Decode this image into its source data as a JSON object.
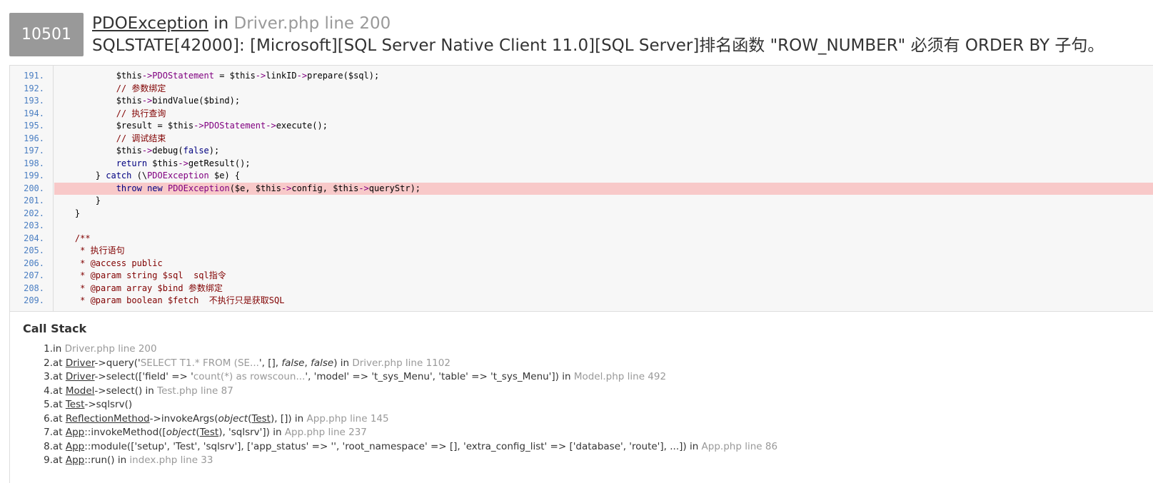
{
  "header": {
    "code": "10501",
    "exception_class": "PDOException",
    "in_word": "in",
    "location": "Driver.php line 200",
    "message": "SQLSTATE[42000]: [Microsoft][SQL Server Native Client 11.0][SQL Server]排名函数 \"ROW_NUMBER\" 必须有 ORDER BY 子句。"
  },
  "source": {
    "highlight_line": "200.",
    "lines": [
      {
        "no": "191.",
        "code": "            $this->PDOStatement = $this->linkID->prepare($sql);"
      },
      {
        "no": "192.",
        "code": "            // 参数绑定"
      },
      {
        "no": "193.",
        "code": "            $this->bindValue($bind);"
      },
      {
        "no": "194.",
        "code": "            // 执行查询"
      },
      {
        "no": "195.",
        "code": "            $result = $this->PDOStatement->execute();"
      },
      {
        "no": "196.",
        "code": "            // 调试结束"
      },
      {
        "no": "197.",
        "code": "            $this->debug(false);"
      },
      {
        "no": "198.",
        "code": "            return $this->getResult();"
      },
      {
        "no": "199.",
        "code": "        } catch (\\PDOException $e) {"
      },
      {
        "no": "200.",
        "code": "            throw new PDOException($e, $this->config, $this->queryStr);"
      },
      {
        "no": "201.",
        "code": "        }"
      },
      {
        "no": "202.",
        "code": "    }"
      },
      {
        "no": "203.",
        "code": ""
      },
      {
        "no": "204.",
        "code": "    /**"
      },
      {
        "no": "205.",
        "code": "     * 执行语句"
      },
      {
        "no": "206.",
        "code": "     * @access public"
      },
      {
        "no": "207.",
        "code": "     * @param string $sql  sql指令"
      },
      {
        "no": "208.",
        "code": "     * @param array $bind 参数绑定"
      },
      {
        "no": "209.",
        "code": "     * @param boolean $fetch  不执行只是获取SQL"
      }
    ]
  },
  "callstack": {
    "title": "Call Stack",
    "items": [
      {
        "num": "1.",
        "parts": [
          {
            "t": "in ",
            "k": "txt"
          },
          {
            "t": "Driver.php line 200",
            "k": "loc"
          }
        ]
      },
      {
        "num": "2.",
        "parts": [
          {
            "t": "at ",
            "k": "txt"
          },
          {
            "t": "Driver",
            "k": "cls"
          },
          {
            "t": "->query('",
            "k": "txt"
          },
          {
            "t": "SELECT T1.* FROM (SE...",
            "k": "loc"
          },
          {
            "t": "', [], ",
            "k": "txt"
          },
          {
            "t": "false",
            "k": "it"
          },
          {
            "t": ", ",
            "k": "txt"
          },
          {
            "t": "false",
            "k": "it"
          },
          {
            "t": ") in ",
            "k": "txt"
          },
          {
            "t": "Driver.php line 1102",
            "k": "loc"
          }
        ]
      },
      {
        "num": "3.",
        "parts": [
          {
            "t": "at ",
            "k": "txt"
          },
          {
            "t": "Driver",
            "k": "cls"
          },
          {
            "t": "->select(['field' => '",
            "k": "txt"
          },
          {
            "t": "count(*) as rowscoun...",
            "k": "loc"
          },
          {
            "t": "', 'model' => 't_sys_Menu', 'table' => 't_sys_Menu']) in ",
            "k": "txt"
          },
          {
            "t": "Model.php line 492",
            "k": "loc"
          }
        ]
      },
      {
        "num": "4.",
        "parts": [
          {
            "t": "at ",
            "k": "txt"
          },
          {
            "t": "Model",
            "k": "cls"
          },
          {
            "t": "->select() in ",
            "k": "txt"
          },
          {
            "t": "Test.php line 87",
            "k": "loc"
          }
        ]
      },
      {
        "num": "5.",
        "parts": [
          {
            "t": "at ",
            "k": "txt"
          },
          {
            "t": "Test",
            "k": "cls"
          },
          {
            "t": "->sqlsrv()",
            "k": "txt"
          }
        ]
      },
      {
        "num": "6.",
        "parts": [
          {
            "t": "at ",
            "k": "txt"
          },
          {
            "t": "ReflectionMethod",
            "k": "cls"
          },
          {
            "t": "->invokeArgs(",
            "k": "txt"
          },
          {
            "t": "object",
            "k": "it"
          },
          {
            "t": "(",
            "k": "txt"
          },
          {
            "t": "Test",
            "k": "cls"
          },
          {
            "t": "), []) in ",
            "k": "txt"
          },
          {
            "t": "App.php line 145",
            "k": "loc"
          }
        ]
      },
      {
        "num": "7.",
        "parts": [
          {
            "t": "at ",
            "k": "txt"
          },
          {
            "t": "App",
            "k": "cls"
          },
          {
            "t": "::invokeMethod([",
            "k": "txt"
          },
          {
            "t": "object",
            "k": "it"
          },
          {
            "t": "(",
            "k": "txt"
          },
          {
            "t": "Test",
            "k": "cls"
          },
          {
            "t": "), 'sqlsrv']) in ",
            "k": "txt"
          },
          {
            "t": "App.php line 237",
            "k": "loc"
          }
        ]
      },
      {
        "num": "8.",
        "parts": [
          {
            "t": "at ",
            "k": "txt"
          },
          {
            "t": "App",
            "k": "cls"
          },
          {
            "t": "::module(['setup', 'Test', 'sqlsrv'], ['app_status' => '', 'root_namespace' => [], 'extra_config_list' => ['database', 'route'], ...]) in ",
            "k": "txt"
          },
          {
            "t": "App.php line 86",
            "k": "loc"
          }
        ]
      },
      {
        "num": "9.",
        "parts": [
          {
            "t": "at ",
            "k": "txt"
          },
          {
            "t": "App",
            "k": "cls"
          },
          {
            "t": "::run() in ",
            "k": "txt"
          },
          {
            "t": "index.php line 33",
            "k": "loc"
          }
        ]
      }
    ]
  },
  "colors": {
    "badge_bg": "#999999",
    "highlight_bg": "#f8c9c9",
    "line_number": "#4a7ec2",
    "keyword": "#000080",
    "variable": "#000000",
    "class_name": "#800080",
    "comment": "#800000",
    "location": "#999999"
  }
}
